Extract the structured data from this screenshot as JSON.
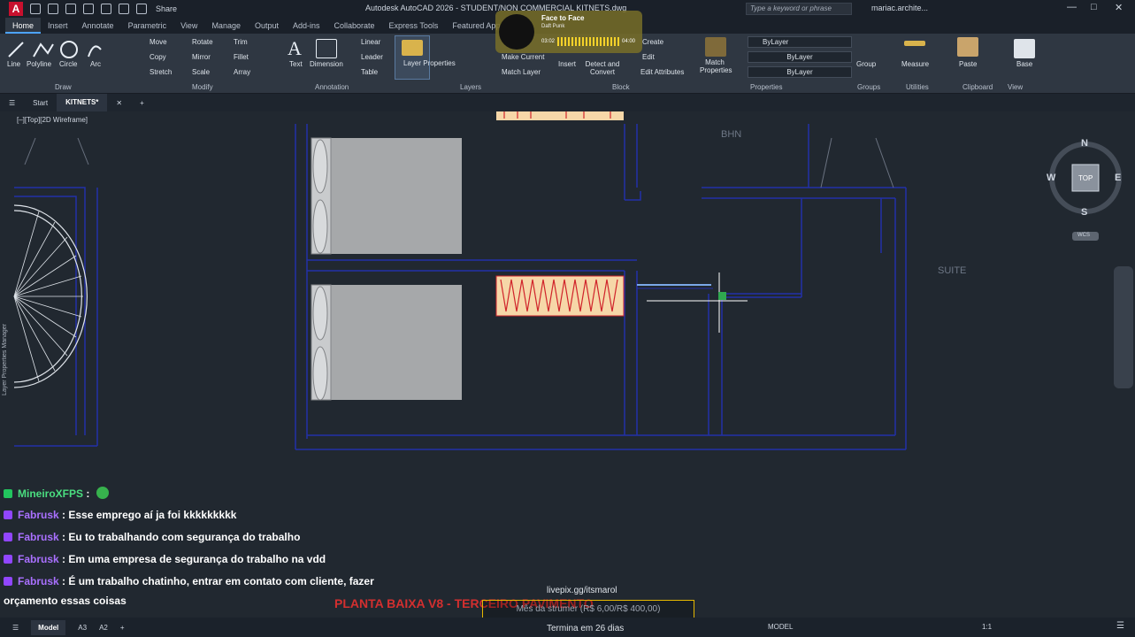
{
  "titlebar": {
    "logo": "A",
    "share": "Share",
    "title": "Autodesk AutoCAD 2026 - STUDENT/NON COMMERCIAL   KITNETS.dwg",
    "search_placeholder": "Type a keyword or phrase",
    "user": "mariac.archite..."
  },
  "ribbon_tabs": [
    "Home",
    "Insert",
    "Annotate",
    "Parametric",
    "View",
    "Manage",
    "Output",
    "Add-ins",
    "Collaborate",
    "Express Tools",
    "Featured Apps"
  ],
  "ribbon": {
    "draw": {
      "title": "Draw",
      "tools": [
        "Line",
        "Polyline",
        "Circle",
        "Arc"
      ]
    },
    "modify": {
      "title": "Modify",
      "tools": [
        "Move",
        "Rotate",
        "Trim",
        "Copy",
        "Mirror",
        "Fillet",
        "Stretch",
        "Scale",
        "Array"
      ]
    },
    "annotation": {
      "title": "Annotation",
      "tools": [
        "Text",
        "Dimension",
        "Linear",
        "Leader",
        "Table"
      ]
    },
    "layers": {
      "title": "Layers",
      "tools": [
        "Layer Properties",
        "Make Current",
        "Match Layer"
      ]
    },
    "block": {
      "title": "Block",
      "tools": [
        "Insert",
        "Create",
        "Edit",
        "Detect and Convert",
        "Edit Attributes"
      ]
    },
    "properties": {
      "title": "Properties",
      "match": "Match Properties",
      "bylayer": [
        "ByLayer",
        "ByLayer",
        "ByLayer"
      ]
    },
    "groups": {
      "title": "Groups",
      "tool": "Group"
    },
    "utilities": {
      "title": "Utilities",
      "tool": "Measure"
    },
    "clipboard": {
      "title": "Clipboard",
      "tool": "Paste"
    },
    "view": {
      "title": "View",
      "tool": "Base"
    }
  },
  "doctabs": {
    "start": "Start",
    "active": "KITNETS*"
  },
  "canvas": {
    "view_label": "[–][Top][2D Wireframe]",
    "side_label": "Layer Properties Manager",
    "room_labels": [
      "BHN",
      "SUITE"
    ],
    "viewcube": {
      "n": "N",
      "s": "S",
      "e": "E",
      "w": "W",
      "top": "TOP",
      "wcs": "WCS"
    }
  },
  "music": {
    "title": "Face to Face",
    "artist": "Daft Punk",
    "elapsed": "03:02",
    "total": "04:00"
  },
  "chat": [
    {
      "user": "MineiroXFPS",
      "text": ":"
    },
    {
      "user": "Fabrusk",
      "text": ": Esse emprego aí ja foi kkkkkkkkk"
    },
    {
      "user": "Fabrusk",
      "text": ": Eu to trabalhando com segurança do trabalho"
    },
    {
      "user": "Fabrusk",
      "text": ": Em uma empresa de segurança do trabalho na vdd"
    },
    {
      "user": "Fabrusk",
      "text": ": É um trabalho chatinho, entrar em contato com cliente, fazer"
    },
    {
      "user": "",
      "text": "orçamento essas coisas"
    }
  ],
  "overlay": {
    "livepix": "livepix.gg/itsmarol",
    "goal": "Mês da strumer (R$ 6,00/R$ 400,00)",
    "goal_ends": "Termina em 26 dias",
    "plan_title": "PLANTA BAIXA V8 - TERCEIRO PAVIMENTO"
  },
  "statusbar": {
    "tabs": [
      "Model",
      "A3",
      "A2"
    ],
    "model_label": "MODEL",
    "scale": "1:1"
  },
  "colors": {
    "accent": "#4da3ff",
    "wall": "#2230a8",
    "furniture": "#a6a8aa",
    "radiator_fill": "#f6d7a8",
    "radiator_stroke": "#d0242b",
    "chat_user": "#a970ff"
  }
}
